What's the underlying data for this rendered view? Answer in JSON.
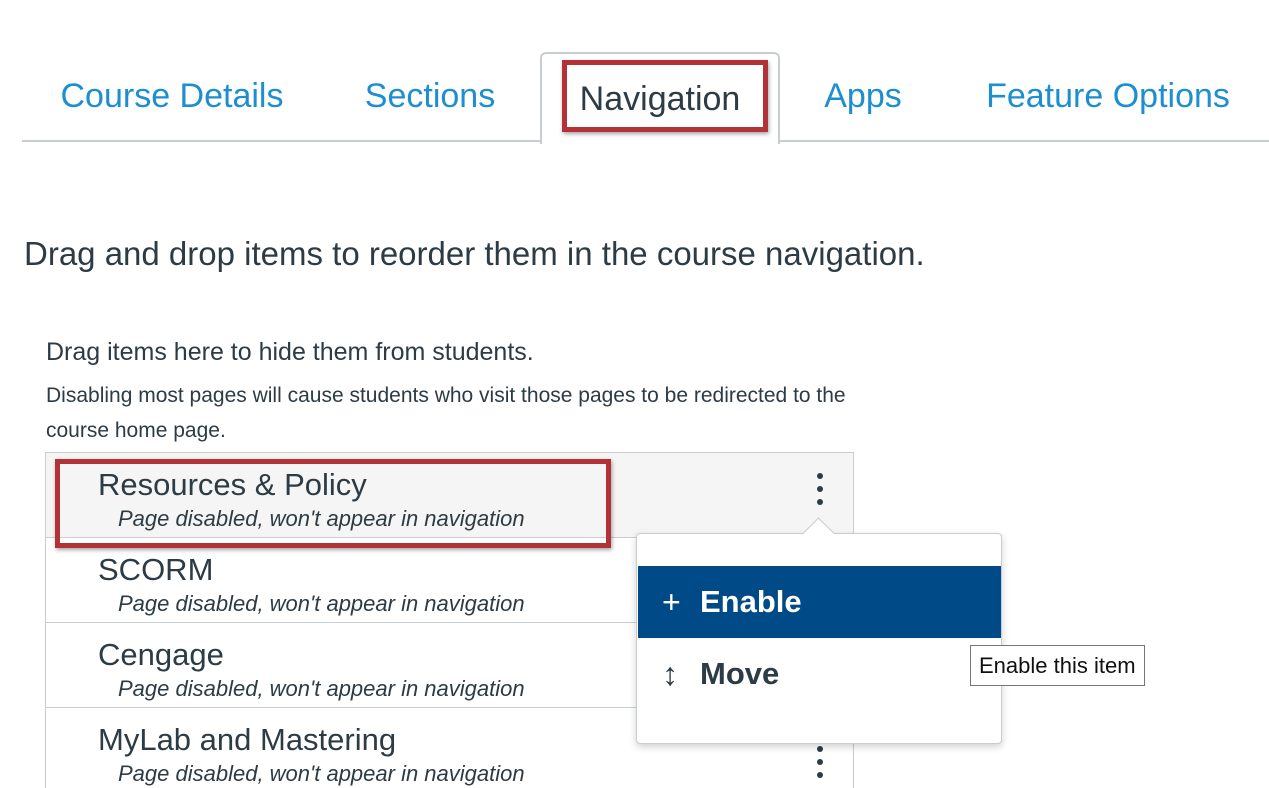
{
  "tabs": [
    {
      "label": "Course Details",
      "active": false
    },
    {
      "label": "Sections",
      "active": false
    },
    {
      "label": "Navigation",
      "active": true
    },
    {
      "label": "Apps",
      "active": false
    },
    {
      "label": "Feature Options",
      "active": false
    }
  ],
  "instructions": "Drag and drop items to reorder them in the course navigation.",
  "hidden_section": {
    "heading": "Drag items here to hide them from students.",
    "note": "Disabling most pages will cause students who visit those pages to be redirected to the course home page.",
    "items": [
      {
        "title": "Resources & Policy",
        "status": "Page disabled, won't appear in navigation"
      },
      {
        "title": "SCORM",
        "status": "Page disabled, won't appear in navigation"
      },
      {
        "title": "Cengage",
        "status": "Page disabled, won't appear in navigation"
      },
      {
        "title": "MyLab and Mastering",
        "status": "Page disabled, won't appear in navigation"
      }
    ]
  },
  "menu": {
    "enable": {
      "icon": "+",
      "label": "Enable"
    },
    "move": {
      "icon": "↕",
      "label": "Move"
    }
  },
  "tooltip": "Enable this item",
  "colors": {
    "link": "#1d8ed0",
    "text": "#2d3b45",
    "menu_active_bg": "#004a87",
    "highlight": "#b33237",
    "border": "#c7cdd1"
  }
}
